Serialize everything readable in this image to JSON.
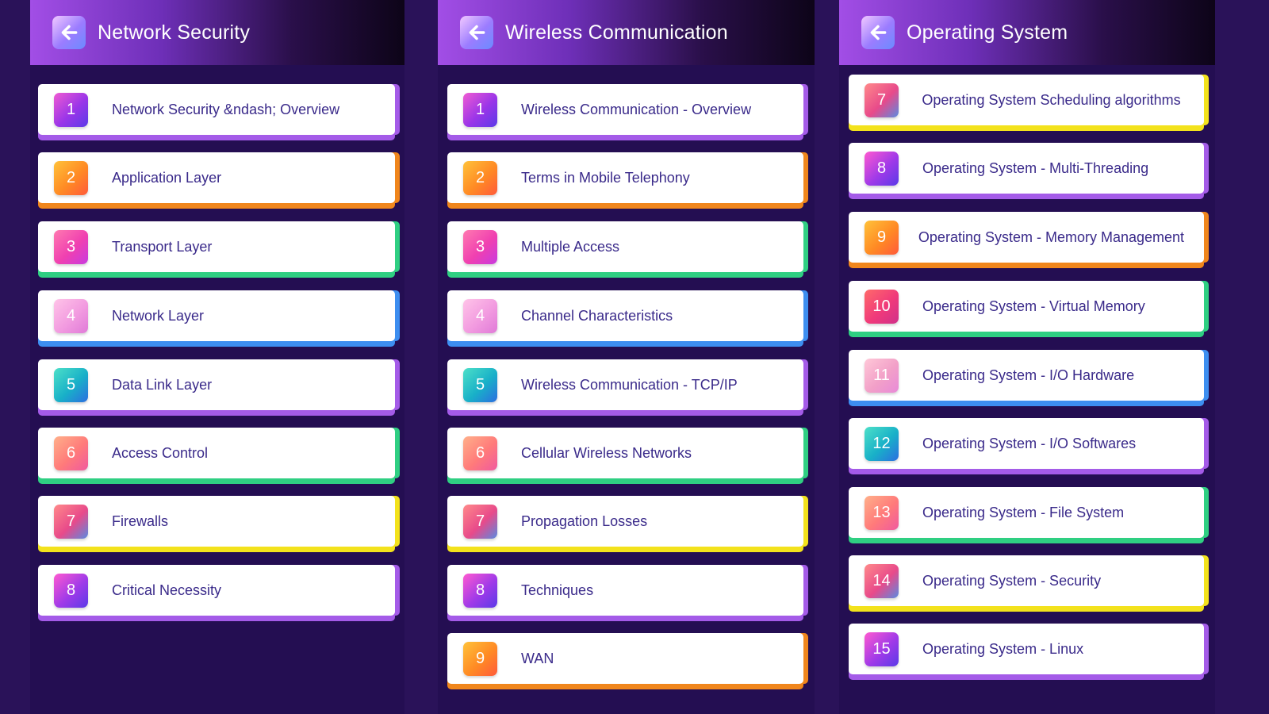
{
  "colors": {
    "background": "#2a1259",
    "panel": "#240e52",
    "label_text": "#3a2a8a",
    "accent_purple": "#a45be8",
    "accent_orange": "#f0861c",
    "accent_green": "#2fcf82",
    "accent_blue": "#3d8ef0",
    "accent_yellow": "#f3e21c"
  },
  "screens": [
    {
      "title": "Network Security",
      "back_icon": "arrow-left-icon",
      "items": [
        {
          "number": "1",
          "label": "Network Security &ndash; Overview",
          "accent": "purple"
        },
        {
          "number": "2",
          "label": "Application Layer",
          "accent": "orange"
        },
        {
          "number": "3",
          "label": "Transport Layer",
          "accent": "green"
        },
        {
          "number": "4",
          "label": "Network Layer",
          "accent": "blue"
        },
        {
          "number": "5",
          "label": "Data Link Layer",
          "accent": "purple"
        },
        {
          "number": "6",
          "label": "Access Control",
          "accent": "green"
        },
        {
          "number": "7",
          "label": "Firewalls",
          "accent": "yellow"
        },
        {
          "number": "8",
          "label": "Critical Necessity",
          "accent": "purple"
        }
      ]
    },
    {
      "title": "Wireless Communication",
      "back_icon": "arrow-left-icon",
      "items": [
        {
          "number": "1",
          "label": "Wireless Communication - Overview",
          "accent": "purple"
        },
        {
          "number": "2",
          "label": "Terms in Mobile Telephony",
          "accent": "orange"
        },
        {
          "number": "3",
          "label": "Multiple Access",
          "accent": "green"
        },
        {
          "number": "4",
          "label": "Channel Characteristics",
          "accent": "blue"
        },
        {
          "number": "5",
          "label": "Wireless Communication - TCP/IP",
          "accent": "purple"
        },
        {
          "number": "6",
          "label": "Cellular Wireless Networks",
          "accent": "green"
        },
        {
          "number": "7",
          "label": "Propagation Losses",
          "accent": "yellow"
        },
        {
          "number": "8",
          "label": "Techniques",
          "accent": "purple"
        },
        {
          "number": "9",
          "label": "WAN",
          "accent": "orange"
        }
      ]
    },
    {
      "title": "Operating System",
      "back_icon": "arrow-left-icon",
      "items": [
        {
          "number": "7",
          "label": "Operating System Scheduling algorithms",
          "accent": "yellow"
        },
        {
          "number": "8",
          "label": "Operating System - Multi-Threading",
          "accent": "purple"
        },
        {
          "number": "9",
          "label": "Operating System - Memory Management",
          "accent": "orange"
        },
        {
          "number": "10",
          "label": "Operating System - Virtual Memory",
          "accent": "green"
        },
        {
          "number": "11",
          "label": "Operating System - I/O Hardware",
          "accent": "blue"
        },
        {
          "number": "12",
          "label": "Operating System - I/O Softwares",
          "accent": "purple"
        },
        {
          "number": "13",
          "label": "Operating System - File System",
          "accent": "green"
        },
        {
          "number": "14",
          "label": "Operating System - Security",
          "accent": "yellow"
        },
        {
          "number": "15",
          "label": "Operating System - Linux",
          "accent": "purple"
        }
      ]
    }
  ]
}
